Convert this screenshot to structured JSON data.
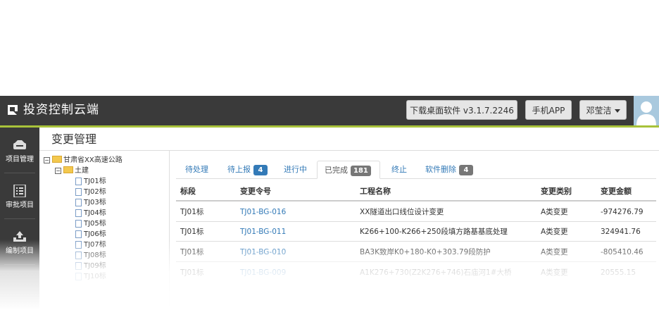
{
  "app": {
    "title": "投资控制云端"
  },
  "header": {
    "download_label": "下载桌面软件 v3.1.7.2246",
    "mobile_label": "手机APP",
    "user_name": "邓莹洁"
  },
  "colors": {
    "topbar": "#3a3a3a",
    "accent": "#a8c23a",
    "link": "#337ab7",
    "badge_blue": "#337ab7",
    "badge_gray": "#777777"
  },
  "sidebar": {
    "items": [
      {
        "label": "项目管理",
        "icon": "project-icon"
      },
      {
        "label": "审批项目",
        "icon": "checklist-icon"
      },
      {
        "label": "编制项目",
        "icon": "upload-icon"
      }
    ]
  },
  "page": {
    "title": "变更管理"
  },
  "tree": {
    "root": "甘肃省XX高速公路",
    "group": "土建",
    "leaves": [
      "TJ01标",
      "TJ02标",
      "TJ03标",
      "TJ04标",
      "TJ05标",
      "TJ06标",
      "TJ07标",
      "TJ08标",
      "TJ09标",
      "TJ10标"
    ]
  },
  "tabs": [
    {
      "label": "待处理"
    },
    {
      "label": "待上报",
      "count": "4"
    },
    {
      "label": "进行中"
    },
    {
      "label": "已完成",
      "count": "181"
    },
    {
      "label": "终止"
    },
    {
      "label": "软件删除",
      "count": "4"
    }
  ],
  "table": {
    "columns": [
      "标段",
      "变更令号",
      "工程名称",
      "变更类别",
      "变更金额"
    ],
    "rows": [
      [
        "TJ01标",
        "TJ01-BG-016",
        "XX隧道出口线位设计变更",
        "A类变更",
        "-974276.79"
      ],
      [
        "TJ01标",
        "TJ01-BG-011",
        "K266+100-K266+250段填方路基基底处理",
        "A类变更",
        "324941.76"
      ],
      [
        "TJ01标",
        "TJ01-BG-010",
        "BA3K致岸K0+180-K0+303.79段防护",
        "A类变更",
        "-805410.46"
      ],
      [
        "TJ01标",
        "TJ01-BG-009",
        "A1K276+730(Z2K276+746)石庙河1#大桥",
        "A类变更",
        "20555.15"
      ]
    ]
  }
}
